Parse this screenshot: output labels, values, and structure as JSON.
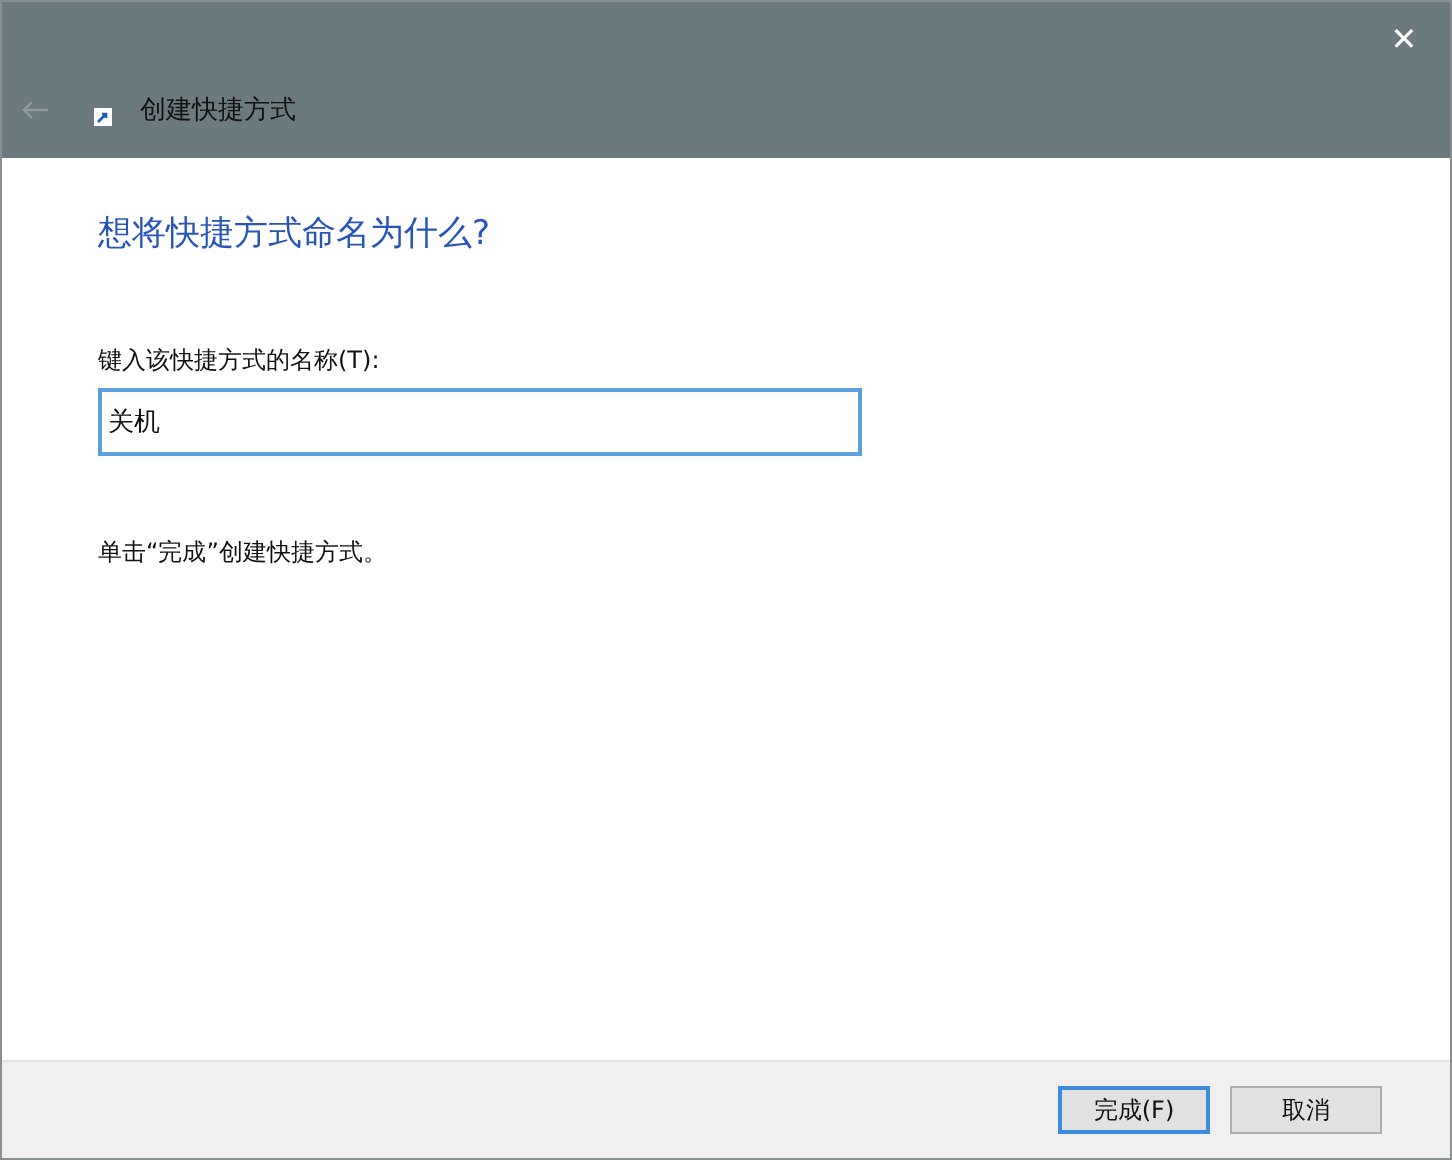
{
  "window": {
    "title": "创建快捷方式",
    "close": "✕"
  },
  "heading": "想将快捷方式命名为什么?",
  "name_field": {
    "label": "键入该快捷方式的名称(T):",
    "value": "关机"
  },
  "hint": "单击“完成”创建快捷方式。",
  "buttons": [
    {
      "label": "完成(F)",
      "default": true
    },
    {
      "label": "取消",
      "default": false
    }
  ]
}
